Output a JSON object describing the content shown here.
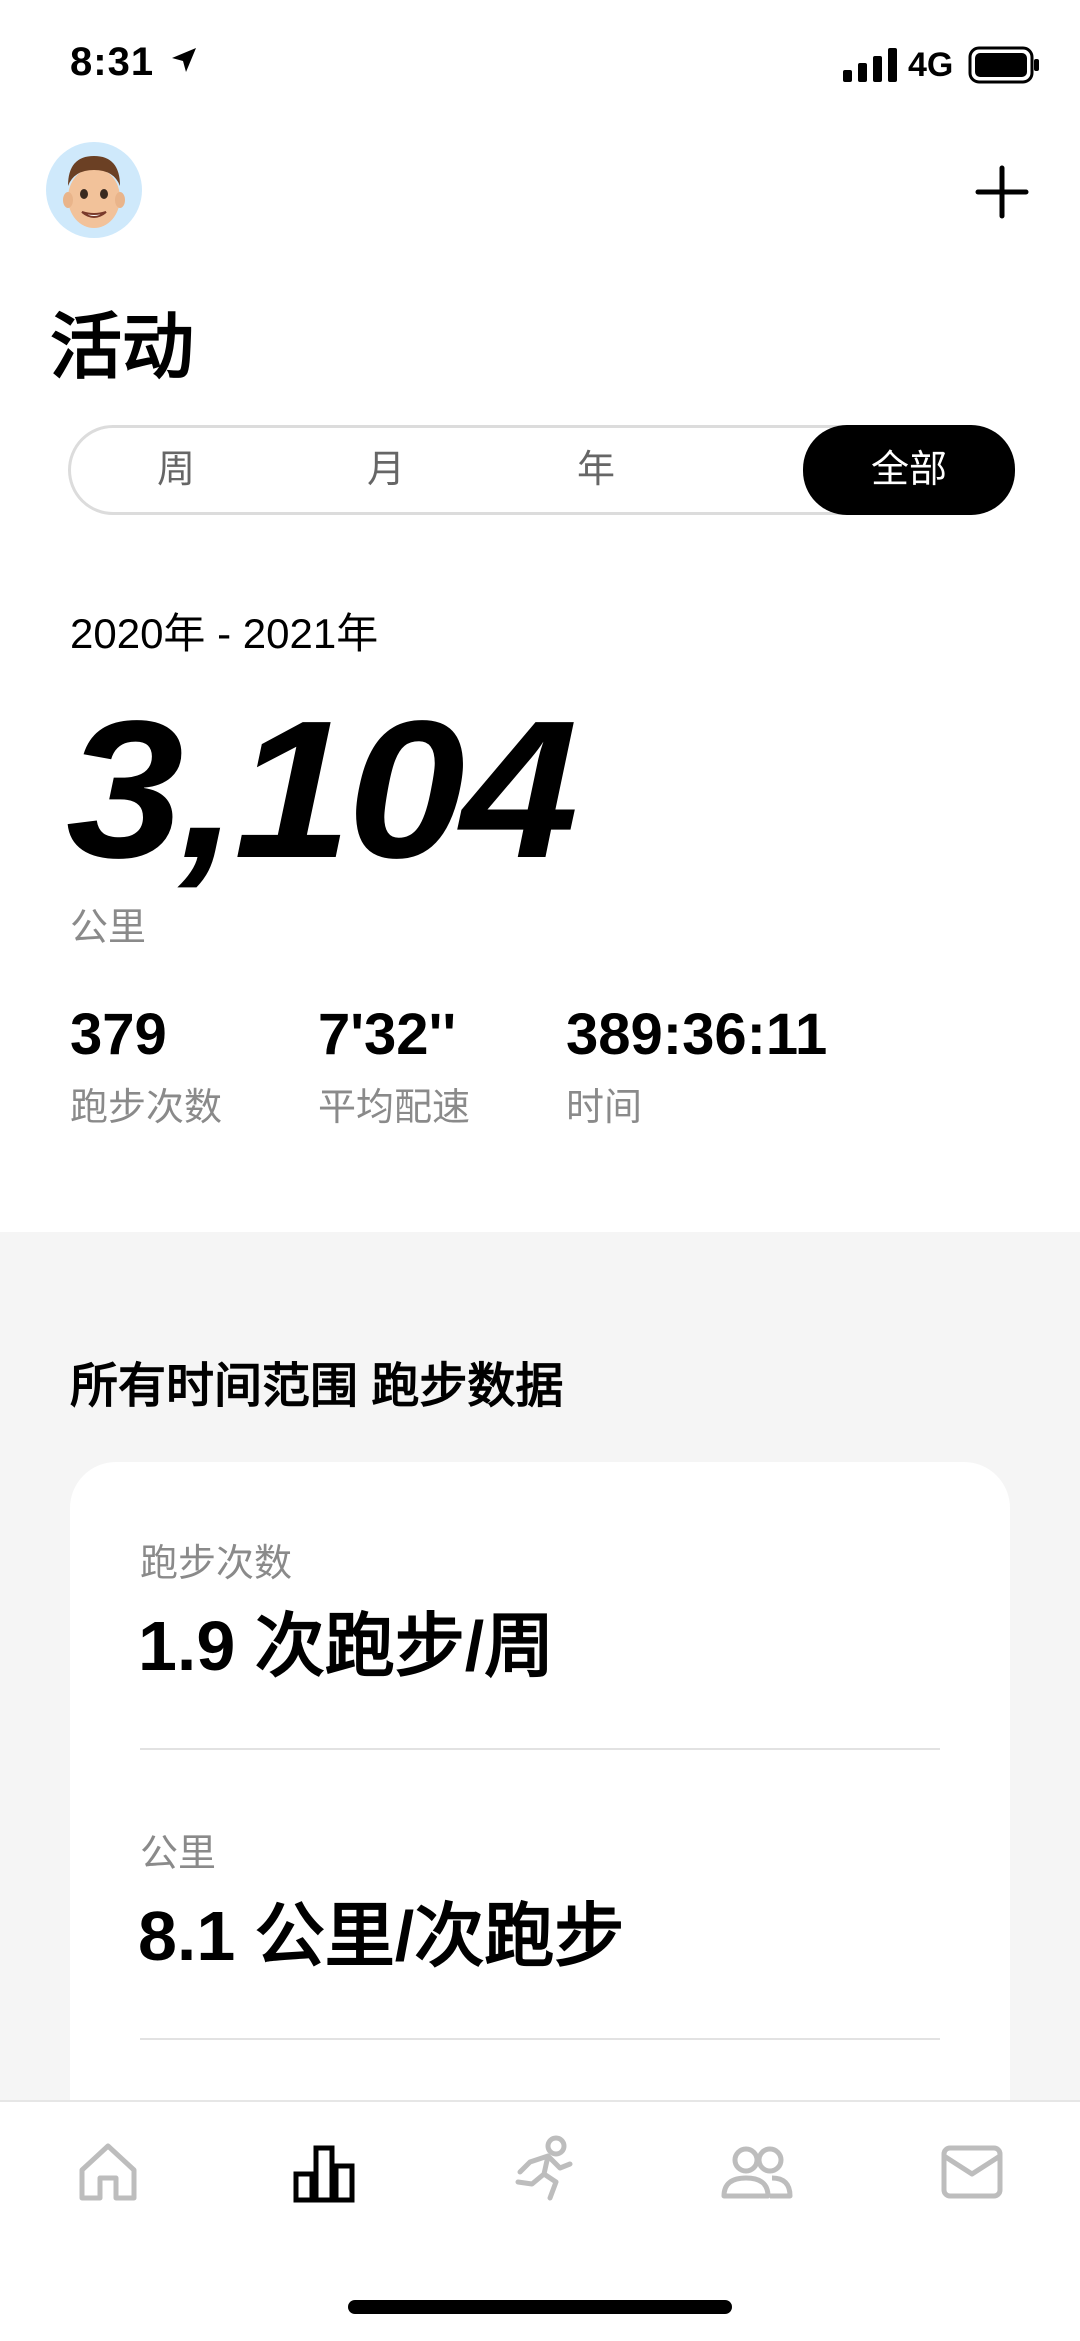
{
  "status_bar": {
    "time": "8:31",
    "network": "4G"
  },
  "header": {
    "title": "活动"
  },
  "segments": [
    {
      "label": "周"
    },
    {
      "label": "月"
    },
    {
      "label": "年"
    },
    {
      "label": "全部"
    }
  ],
  "summary": {
    "date_range": "2020年 - 2021年",
    "distance": "3,104",
    "distance_unit": "公里",
    "stats": [
      {
        "value": "379",
        "label": "跑步次数"
      },
      {
        "value": "7'32''",
        "label": "平均配速"
      },
      {
        "value": "389:36:11",
        "label": "时间"
      }
    ]
  },
  "all_time": {
    "title": "所有时间范围 跑步数据",
    "items": [
      {
        "label": "跑步次数",
        "value": "1.9 次跑步/周"
      },
      {
        "label": "公里",
        "value": "8.1 公里/次跑步"
      }
    ]
  },
  "colors": {
    "accent": "#000000",
    "muted": "#8a8a8a",
    "section_bg": "#f5f5f5"
  },
  "tab_bar": {
    "icons": [
      "home-icon",
      "activity-icon",
      "run-icon",
      "community-icon",
      "inbox-icon"
    ],
    "active": 1
  }
}
